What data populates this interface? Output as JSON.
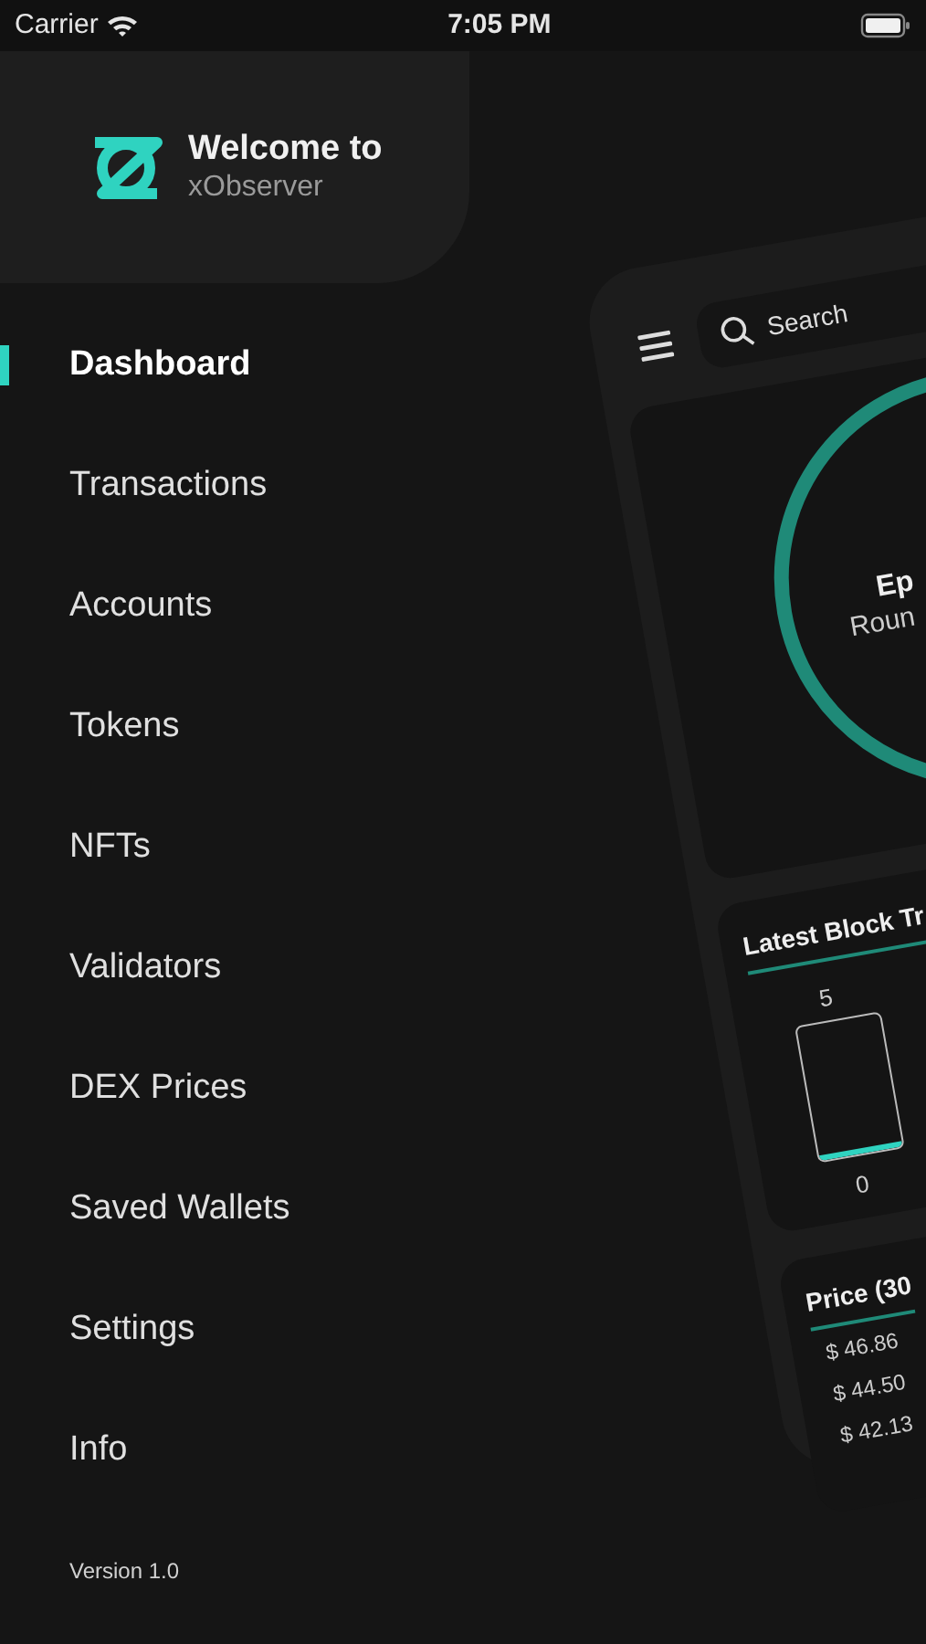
{
  "status_bar": {
    "carrier": "Carrier",
    "time": "7:05 PM"
  },
  "header": {
    "title": "Welcome to",
    "subtitle": "xObserver"
  },
  "menu": [
    {
      "label": "Dashboard",
      "selected": true
    },
    {
      "label": "Transactions",
      "selected": false
    },
    {
      "label": "Accounts",
      "selected": false
    },
    {
      "label": "Tokens",
      "selected": false
    },
    {
      "label": "NFTs",
      "selected": false
    },
    {
      "label": "Validators",
      "selected": false
    },
    {
      "label": "DEX Prices",
      "selected": false
    },
    {
      "label": "Saved Wallets",
      "selected": false
    },
    {
      "label": "Settings",
      "selected": false
    },
    {
      "label": "Info",
      "selected": false
    }
  ],
  "version": "Version 1.0",
  "preview": {
    "search": {
      "placeholder": "Search"
    },
    "epoch": {
      "title": "Ep",
      "subtitle": "Roun"
    },
    "latest_block": {
      "title": "Latest Block Tr",
      "max": "5",
      "min": "0",
      "level": 0.04
    },
    "price": {
      "title": "Price (30",
      "values": [
        "$ 46.86",
        "$ 44.50",
        "$ 42.13"
      ]
    }
  }
}
